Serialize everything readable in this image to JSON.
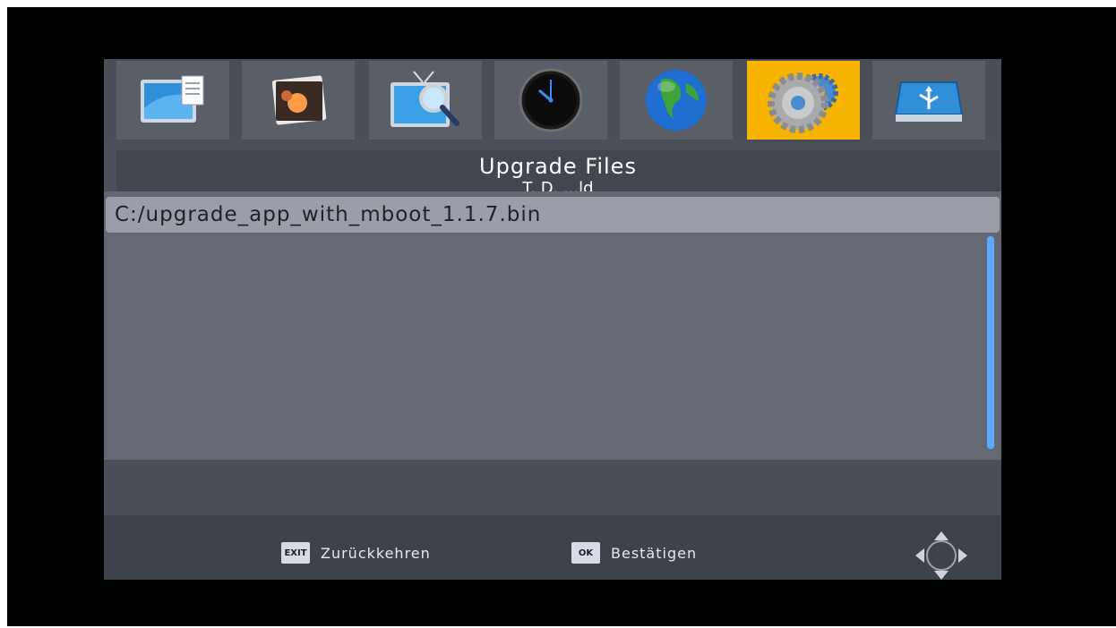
{
  "header": {
    "title": "Upgrade Files",
    "subtitle": "T. D. ...ld"
  },
  "tabs": [
    {
      "icon": "documents-icon",
      "selected": false
    },
    {
      "icon": "photos-icon",
      "selected": false
    },
    {
      "icon": "tv-search-icon",
      "selected": false
    },
    {
      "icon": "clock-icon",
      "selected": false
    },
    {
      "icon": "globe-icon",
      "selected": false
    },
    {
      "icon": "gears-icon",
      "selected": true
    },
    {
      "icon": "usb-drive-icon",
      "selected": false
    }
  ],
  "file_list": {
    "items": [
      "C:/upgrade_app_with_mboot_1.1.7.bin"
    ]
  },
  "footer": {
    "exit_key": "EXIT",
    "exit_label": "Zurückkehren",
    "ok_key": "OK",
    "ok_label": "Bestätigen",
    "nav_icon": "dpad-icon"
  },
  "colors": {
    "selected_tab": "#f6b400",
    "list_highlight": "#9a9ea8",
    "scrollbar": "#5aa8ff"
  }
}
